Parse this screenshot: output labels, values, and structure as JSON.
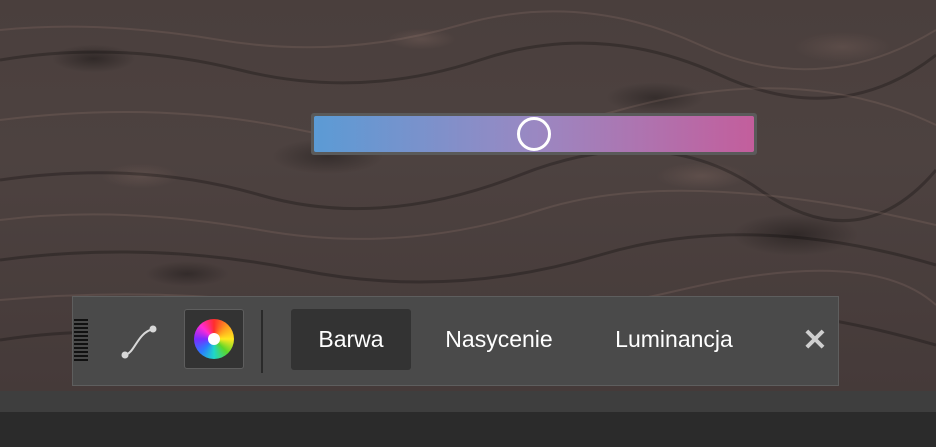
{
  "image": {
    "description_icon": "textured-ground-photo"
  },
  "hue_slider": {
    "value": 0.5,
    "gradient_start": "#5b9bd5",
    "gradient_mid": "#9a88c2",
    "gradient_end": "#c35e9c"
  },
  "toolbar": {
    "grip_icon": "drag-grip-icon",
    "curve_icon": "curve-icon",
    "wheel_icon": "color-wheel-icon",
    "tabs": [
      {
        "label": "Barwa",
        "active": true
      },
      {
        "label": "Nasycenie",
        "active": false
      },
      {
        "label": "Luminancja",
        "active": false
      }
    ],
    "close_icon": "close-icon",
    "close_glyph": "✕"
  },
  "colors": {
    "toolbar_bg": "#4a4a4a",
    "active_tab_bg": "#333333",
    "text": "#ffffff"
  }
}
